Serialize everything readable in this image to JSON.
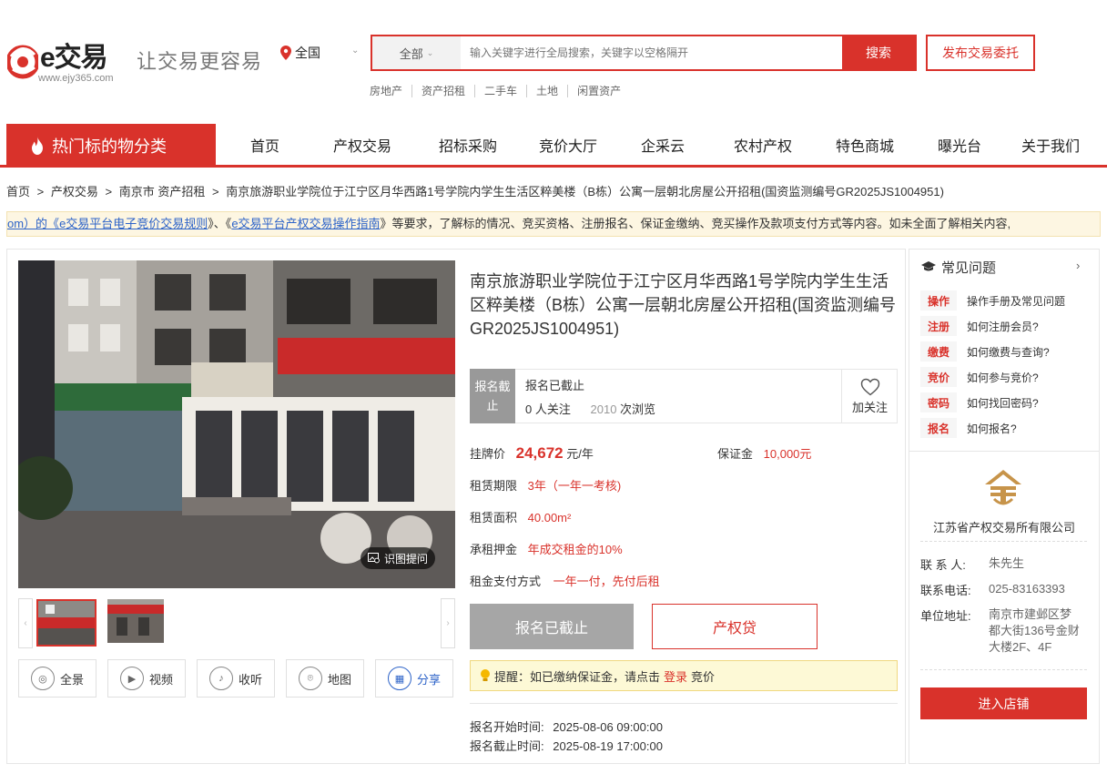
{
  "header": {
    "logo_text": "e交易",
    "logo_url": "www.ejy365.com",
    "slogan": "让交易更容易",
    "city": "全国",
    "search": {
      "category": "全部",
      "placeholder": "输入关键字进行全局搜索，关键字以空格隔开",
      "button": "搜索"
    },
    "publish_button": "发布交易委托",
    "quick_links": [
      "房地产",
      "资产招租",
      "二手车",
      "土地",
      "闲置资产"
    ]
  },
  "nav": {
    "hot_category": "热门标的物分类",
    "items": [
      "首页",
      "产权交易",
      "招标采购",
      "竞价大厅",
      "企采云",
      "农村产权",
      "特色商城",
      "曝光台",
      "关于我们"
    ]
  },
  "breadcrumb": {
    "items": [
      "首页",
      "产权交易",
      "南京市 资产招租",
      "南京旅游职业学院位于江宁区月华西路1号学院内学生生活区粹美楼（B栋）公寓一层朝北房屋公开招租(国资监测编号GR2025JS1004951)"
    ],
    "separator": ">"
  },
  "notice": {
    "prefix": "om）的《",
    "link1": "e交易平台电子竞价交易规则",
    "mid": "》、《",
    "link2": "e交易平台产权交易操作指南",
    "suffix": "》等要求，了解标的情况、竞买资格、注册报名、保证金缴纳、竞买操作及款项支付方式等内容。如未全面了解相关内容,"
  },
  "listing": {
    "title": "南京旅游职业学院位于江宁区月华西路1号学院内学生生活区粹美楼（B栋）公寓一层朝北房屋公开招租(国资监测编号GR2025JS1004951)",
    "photo_tag": "识图提问",
    "status_tag": "报名截止",
    "status_text": "报名已截止",
    "followers": "0",
    "followers_label": "人关注",
    "views": "2010",
    "views_label": "次浏览",
    "favorite_label": "加关注",
    "price_label": "挂牌价",
    "price_value": "24,672",
    "price_unit": "元/年",
    "deposit_label": "保证金",
    "deposit_value": "10,000元",
    "term_label": "租赁期限",
    "term_value": "3年（一年一考核)",
    "area_label": "租赁面积",
    "area_value": "40.00m²",
    "rent_deposit_label": "承租押金",
    "rent_deposit_value": "年成交租金的10%",
    "payment_label": "租金支付方式",
    "payment_value": "一年一付，先付后租",
    "btn_closed": "报名已截止",
    "btn_loan": "产权贷",
    "tip_prefix": "提醒：如已缴纳保证金，请点击",
    "tip_link": "登录",
    "tip_suffix": "竞价",
    "start_label": "报名开始时间:",
    "start_time": "2025-08-06 09:00:00",
    "end_label": "报名截止时间:",
    "end_time": "2025-08-19 17:00:00",
    "tools": [
      {
        "icon": "vr-icon",
        "label": "全景"
      },
      {
        "icon": "video-icon",
        "label": "视频"
      },
      {
        "icon": "microphone-icon",
        "label": "收听"
      },
      {
        "icon": "map-pin-icon",
        "label": "地图"
      },
      {
        "icon": "qrcode-icon",
        "label": "分享"
      }
    ]
  },
  "sidebar": {
    "faq_title": "常见问题",
    "faq": [
      {
        "tag": "操作",
        "text": "操作手册及常见问题"
      },
      {
        "tag": "注册",
        "text": "如何注册会员?"
      },
      {
        "tag": "缴费",
        "text": "如何缴费与查询?"
      },
      {
        "tag": "竞价",
        "text": "如何参与竞价?"
      },
      {
        "tag": "密码",
        "text": "如何找回密码?"
      },
      {
        "tag": "报名",
        "text": "如何报名?"
      }
    ],
    "company": "江苏省产权交易所有限公司",
    "contact_label": "联 系 人:",
    "contact_value": "朱先生",
    "phone_label": "联系电话:",
    "phone_value": "025-83163393",
    "address_label": "单位地址:",
    "address_value": "南京市建邺区梦都大街136号金财大楼2F、4F",
    "enter_button": "进入店铺"
  },
  "colors": {
    "accent": "#d9322b",
    "link": "#2d63c8",
    "muted": "#a6a6a6"
  }
}
